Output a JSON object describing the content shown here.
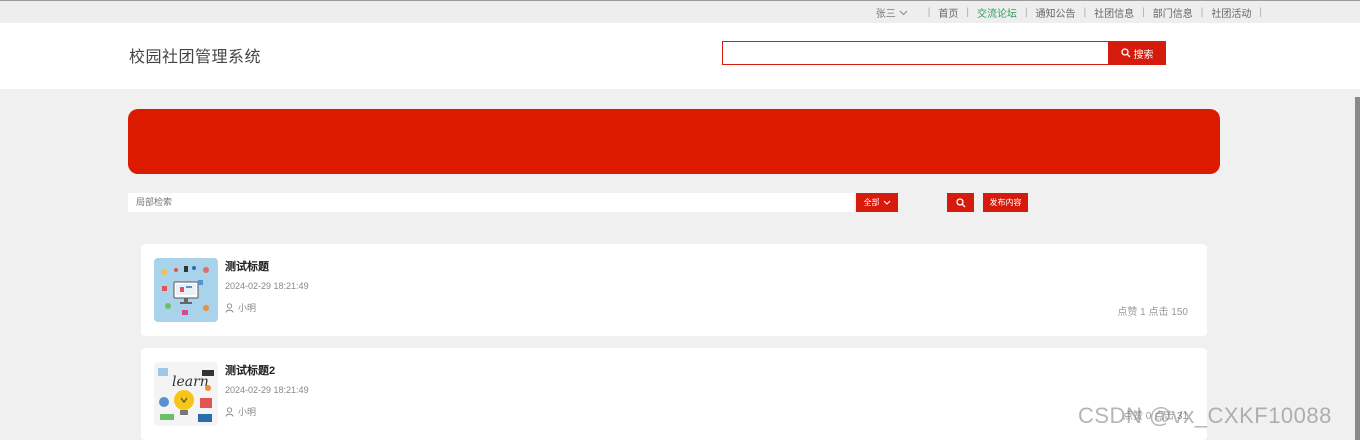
{
  "topnav": {
    "user": "张三",
    "items": [
      "首页",
      "交流论坛",
      "通知公告",
      "社团信息",
      "部门信息",
      "社团活动"
    ],
    "active_index": 1
  },
  "header": {
    "site_title": "校园社团管理系统",
    "search_value": "",
    "search_button": "搜索"
  },
  "colors": {
    "accent": "#d61a0c",
    "banner": "#dc1a00",
    "nav_active": "#3aa76d"
  },
  "filter": {
    "local_search_placeholder": "局部检索",
    "select_value": "全部",
    "publish_label": "发布内容"
  },
  "posts": [
    {
      "title": "测试标题",
      "date": "2024-02-29 18:21:49",
      "author": "小明",
      "stats": "点赞 1 点击 150",
      "thumb_icon": "computer-illustration-icon"
    },
    {
      "title": "测试标题2",
      "date": "2024-02-29 18:21:49",
      "author": "小明",
      "stats": "点赞 0 点击 31",
      "thumb_icon": "learn-illustration-icon"
    }
  ],
  "watermark": "CSDN @vx_CXKF10088"
}
